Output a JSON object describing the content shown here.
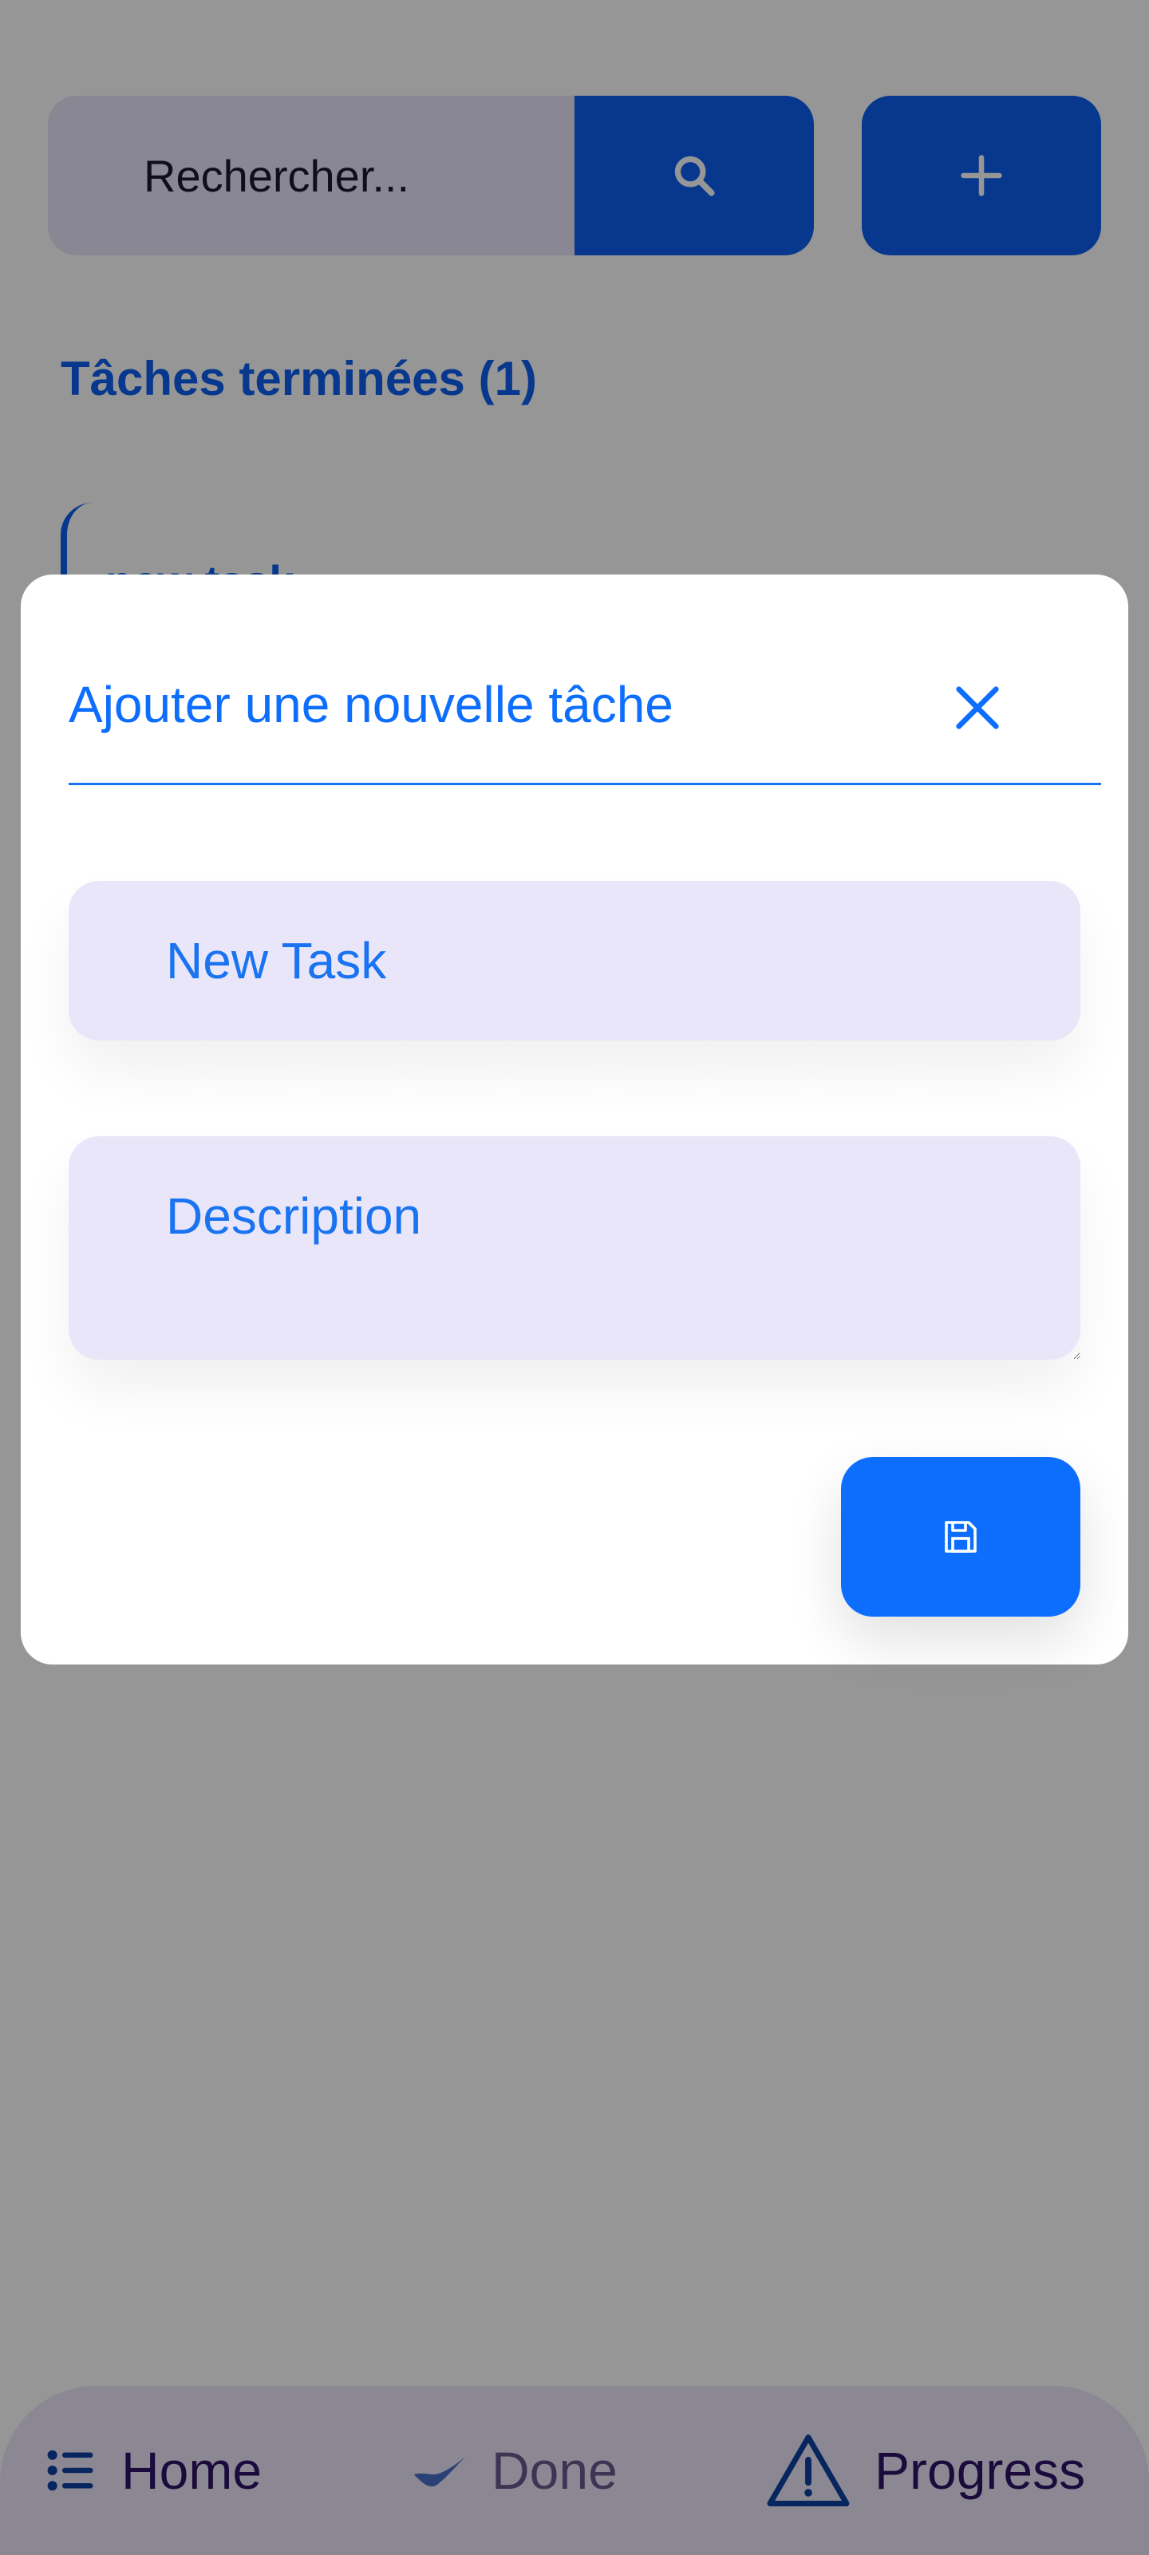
{
  "search": {
    "placeholder": "Rechercher...",
    "search_icon": "search-icon",
    "add_icon": "plus-icon"
  },
  "section": {
    "completed_title": "Tâches terminées (1)",
    "task_title": "new task"
  },
  "modal": {
    "title": "Ajouter une nouvelle tâche",
    "close_icon": "close-icon",
    "task_placeholder": "New Task",
    "description_placeholder": "Description",
    "save_icon": "floppy-disk-icon"
  },
  "bottom_nav": {
    "items": [
      {
        "label": "Home",
        "icon": "list-icon"
      },
      {
        "label": "Done",
        "icon": "check-icon"
      },
      {
        "label": "Progress",
        "icon": "warning-triangle-icon"
      }
    ]
  },
  "colors": {
    "primary": "#0d6efd",
    "field_bg": "#e9e6fa",
    "nav_text": "#2e1466",
    "overlay": "rgba(0,0,0,0.41)"
  }
}
